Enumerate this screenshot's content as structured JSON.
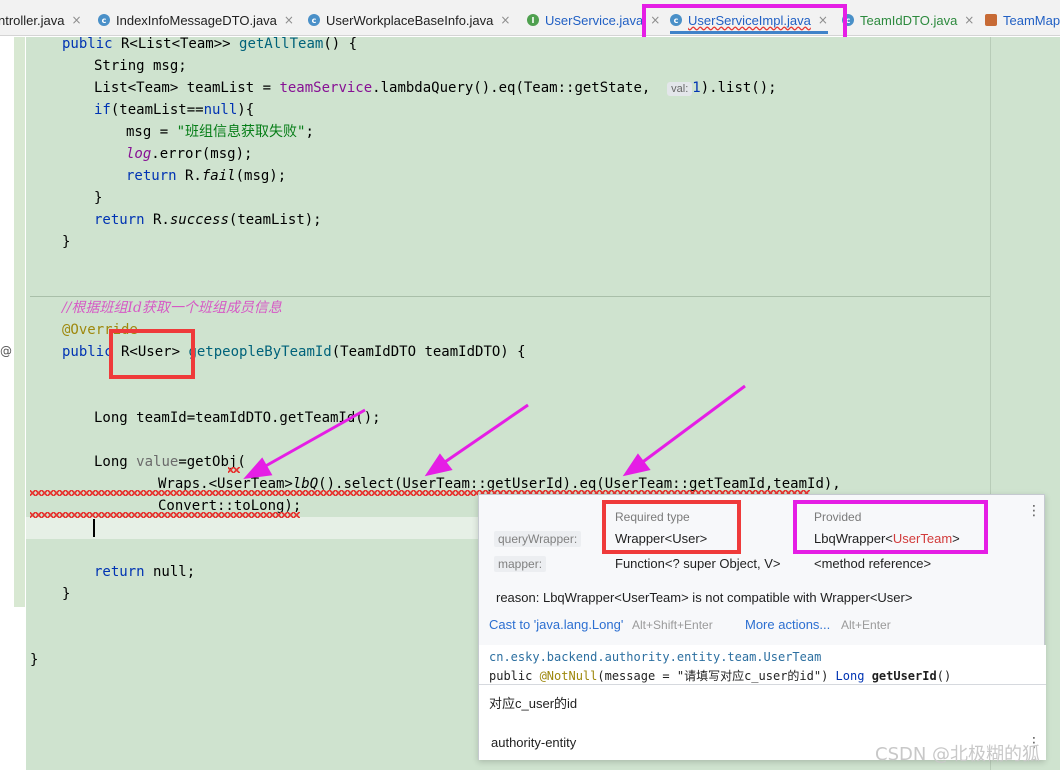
{
  "tabs": [
    {
      "label": "ntroller.java",
      "icon": "java-class-icon"
    },
    {
      "label": "IndexInfoMessageDTO.java",
      "icon": "java-class-icon"
    },
    {
      "label": "UserWorkplaceBaseInfo.java",
      "icon": "java-class-icon"
    },
    {
      "label": "UserService.java",
      "icon": "java-interface-icon"
    },
    {
      "label": "UserServiceImpl.java",
      "icon": "java-class-icon",
      "active": true
    },
    {
      "label": "TeamIdDTO.java",
      "icon": "java-class-icon"
    },
    {
      "label": "TeamMap",
      "icon": "mapper-xml-icon"
    }
  ],
  "tab_close_glyph": "×",
  "tab_icon_glyph_class": "c",
  "tab_icon_glyph_interface": "I",
  "code": {
    "l1_kw": "public",
    "l1_type": " R<List<Team>> ",
    "l1_fn": "getAllTeam",
    "l1_rest": "() {",
    "l2": "String msg;",
    "l3_a": "List<Team> teamList = ",
    "l3_field": "teamService",
    "l3_b": ".lambdaQuery().eq(Team::getState,",
    "l3_hint": "val:",
    "l3_c": "1",
    "l3_d": ").list();",
    "l4_kw": "if",
    "l4_a": "(teamList==",
    "l4_null": "null",
    "l4_b": "){",
    "l5_a": "msg = ",
    "l5_str": "\"班组信息获取失败\"",
    "l5_b": ";",
    "l6_log": "log",
    "l6_b": ".error(msg);",
    "l7_kw": "return",
    "l7_a": " R.",
    "l7_fail": "fail",
    "l7_b": "(msg);",
    "l8": "}",
    "l9_kw": "return",
    "l9_a": " R.",
    "l9_success": "success",
    "l9_b": "(teamList);",
    "l10": "}",
    "comment": "//根据班组Id获取一个班组成员信息",
    "override": "@Override",
    "m_kw": "public",
    "m_type": " R<User> ",
    "m_fn": "getpeopleByTeamId",
    "m_rest": "(TeamIdDTO teamIdDTO) {",
    "teamid_line": "Long teamId=teamIdDTO.getTeamId();",
    "long_a": "Long ",
    "long_value": "value",
    "long_b": "=getObj(",
    "wraps_a": "Wraps.<UserTeam>",
    "wraps_lbq": "lbQ",
    "wraps_b": "().select(UserTeam::getUserId).eq(UserTeam::getTeamId,teamId),",
    "convert": "Convert::toLong);",
    "return_kw": "return",
    "return_null": " null;",
    "close1": "}",
    "close2": "}"
  },
  "gutter_override_mark": "@",
  "popup": {
    "required_header": "Required type",
    "provided_header": "Provided",
    "row1_label": "queryWrapper:",
    "row1_required": "Wrapper<User>",
    "row1_provided_a": "LbqWrapper<",
    "row1_provided_b": "UserTeam",
    "row1_provided_c": ">",
    "row2_label": "mapper:",
    "row2_required": "Function<? super Object, V>",
    "row2_provided": "<method reference>",
    "reason": "reason: LbqWrapper<UserTeam> is not compatible with Wrapper<User>",
    "action1": "Cast to 'java.lang.Long'",
    "action1_shortcut": "Alt+Shift+Enter",
    "action2": "More actions...",
    "action2_shortcut": "Alt+Enter",
    "doc_class": "cn.esky.backend.authority.entity.team.UserTeam",
    "doc_sig_a": "public ",
    "doc_sig_ann": "@NotNull",
    "doc_sig_b": "(message = \"请填写对应c_user的id\") ",
    "doc_sig_long": "Long",
    "doc_sig_method": "getUserId",
    "doc_sig_c": "()",
    "doc_desc": "对应c_user的id",
    "doc_module": "authority-entity",
    "kebab": "⋮"
  },
  "watermark": "CSDN @北极糊的狐"
}
